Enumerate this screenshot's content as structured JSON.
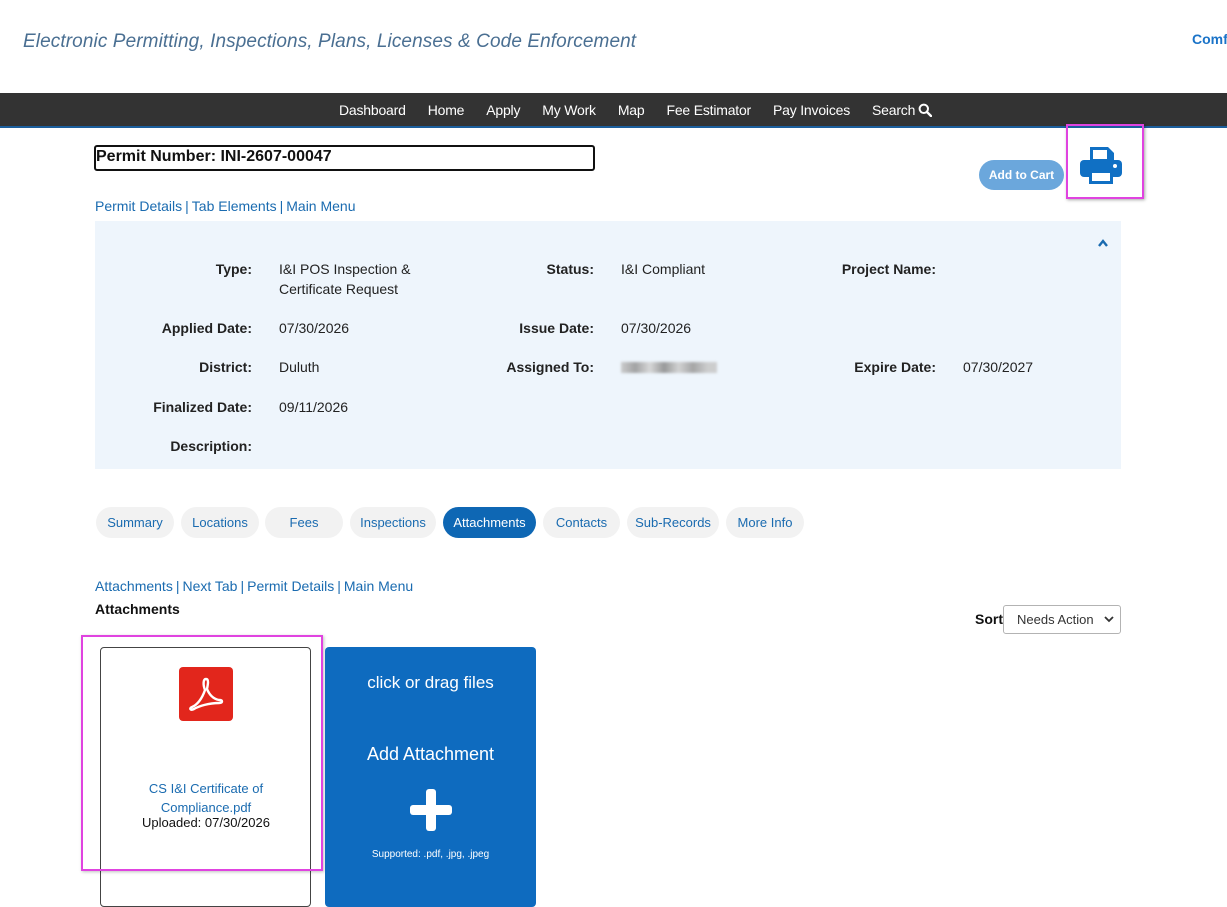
{
  "header": {
    "site_title": "Electronic Permitting, Inspections, Plans, Licenses & Code Enforcement",
    "corner_link": "Comf"
  },
  "nav": {
    "items": [
      "Dashboard",
      "Home",
      "Apply",
      "My Work",
      "Map",
      "Fee Estimator",
      "Pay Invoices"
    ],
    "search_label": "Search"
  },
  "permit": {
    "number_label": "Permit Number: INI-2607-00047",
    "add_to_cart": "Add to Cart",
    "links": [
      "Permit Details",
      "Tab Elements",
      "Main Menu"
    ]
  },
  "details": {
    "type_label": "Type:",
    "type_value": "I&I POS Inspection & Certificate Request",
    "status_label": "Status:",
    "status_value": "I&I Compliant",
    "project_label": "Project Name:",
    "project_value": "",
    "applied_label": "Applied Date:",
    "applied_value": "07/30/2026",
    "issue_label": "Issue Date:",
    "issue_value": "07/30/2026",
    "district_label": "District:",
    "district_value": "Duluth",
    "assigned_label": "Assigned To:",
    "expire_label": "Expire Date:",
    "expire_value": "07/30/2027",
    "finalized_label": "Finalized Date:",
    "finalized_value": "09/11/2026",
    "description_label": "Description:",
    "description_value": ""
  },
  "tabs": {
    "items": [
      "Summary",
      "Locations",
      "Fees",
      "Inspections",
      "Attachments",
      "Contacts",
      "Sub-Records",
      "More Info"
    ],
    "active": "Attachments"
  },
  "attachments": {
    "links": [
      "Attachments",
      "Next Tab",
      "Permit Details",
      "Main Menu"
    ],
    "title": "Attachments",
    "sort_label": "Sort",
    "sort_value": "Needs Action",
    "file": {
      "name": "CS I&I Certificate of Compliance.pdf",
      "uploaded": "Uploaded: 07/30/2026",
      "icon": "pdf-icon"
    },
    "dropzone": {
      "prompt": "click or drag files",
      "add_label": "Add Attachment",
      "supported": "Supported: .pdf, .jpg, .jpeg"
    }
  },
  "colors": {
    "nav_bg": "#333333",
    "accent": "#0e67b4",
    "panel_bg": "#eef5fc",
    "highlight": "#e043e0",
    "pdf_red": "#e2261c"
  }
}
